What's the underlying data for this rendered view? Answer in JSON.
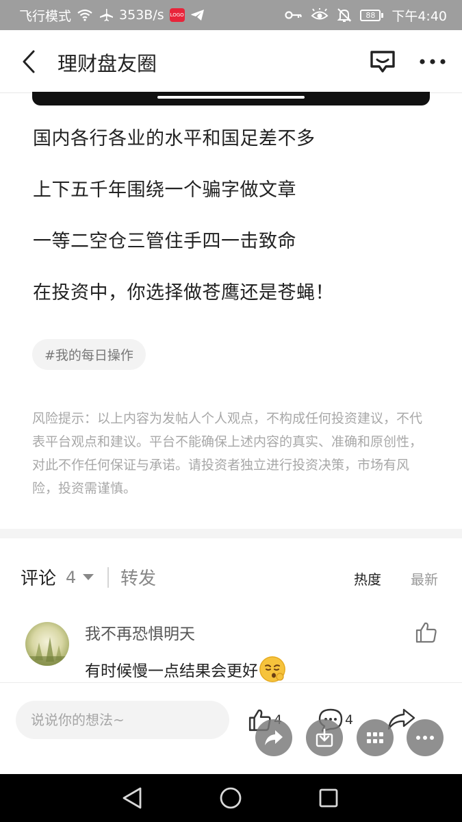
{
  "status_bar": {
    "left_text": "飞行模式",
    "speed": "353B/s",
    "app_badge": "LOGO",
    "battery": "88",
    "time": "下午4:40",
    "icons": [
      "wifi-icon",
      "airplane-icon",
      "app-badge-icon",
      "telegram-icon",
      "key-icon",
      "eye-icon",
      "mute-bell-icon",
      "battery-icon"
    ],
    "bg_color": "#9e9e9e"
  },
  "header": {
    "title": "理财盘友圈"
  },
  "post": {
    "lines": [
      "国内各行各业的水平和国足差不多",
      "上下五千年围绕一个骗字做文章",
      "一等二空仓三管住手四一击致命",
      "在投资中，你选择做苍鹰还是苍蝇！"
    ],
    "tag": "#我的每日操作",
    "risk_notice": "风险提示：以上内容为发帖人个人观点，不构成任何投资建议，不代表平台观点和建议。平台不能确保上述内容的真实、准确和原创性，对此不作任何保证与承诺。请投资者独立进行投资决策，市场有风险，投资需谨慎。"
  },
  "comments_section": {
    "tab_comment": "评论",
    "comment_count": "4",
    "tab_forward": "转发",
    "sort_hot": "热度",
    "sort_new": "最新",
    "comments": [
      {
        "user": "我不再恐惧明天",
        "text": "有时候慢一点结果会更好"
      }
    ]
  },
  "bottom_bar": {
    "input_placeholder": "说说你的想法~",
    "like_count": "4",
    "comment_count": "4"
  }
}
